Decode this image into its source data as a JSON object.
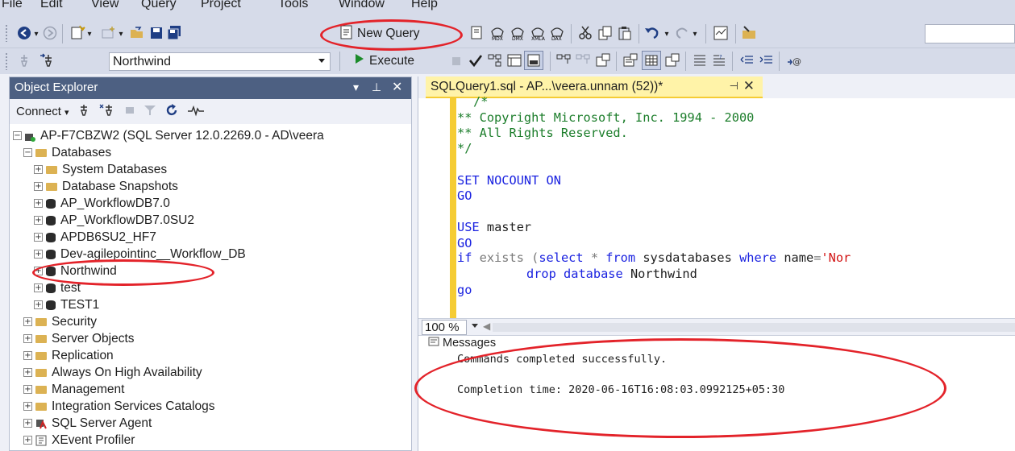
{
  "menu": {
    "items": [
      "File",
      "Edit",
      "View",
      "Query",
      "Project",
      "Tools",
      "Window",
      "Help"
    ]
  },
  "toolbar": {
    "new_query_label": "New Query",
    "database_selected": "Northwind",
    "execute_label": "Execute"
  },
  "object_explorer": {
    "title": "Object Explorer",
    "connect_label": "Connect",
    "server_node": "AP-F7CBZW2 (SQL Server 12.0.2269.0 - AD\\veera",
    "databases_folder": "Databases",
    "database_children": [
      "System Databases",
      "Database Snapshots",
      "AP_WorkflowDB7.0",
      "AP_WorkflowDB7.0SU2",
      "APDB6SU2_HF7",
      "Dev-agilepointinc__Workflow_DB",
      "Northwind",
      "test",
      "TEST1"
    ],
    "server_children": [
      "Security",
      "Server Objects",
      "Replication",
      "Always On High Availability",
      "Management",
      "Integration Services Catalogs",
      "SQL Server Agent",
      "XEvent Profiler"
    ]
  },
  "editor": {
    "tab_title": "SQLQuery1.sql - AP...\\veera.unnam (52))*",
    "code": {
      "l1": "/*",
      "l2": "** Copyright Microsoft, Inc. 1994 - 2000",
      "l3": "** All Rights Reserved.",
      "l4": "*/",
      "l5a": "SET",
      "l5b": "NOCOUNT",
      "l5c": "ON",
      "l6": "GO",
      "l7a": "USE",
      "l7b": "master",
      "l8": "GO",
      "l9a": "if",
      "l9b": "exists",
      "l9c": "(",
      "l9d": "select",
      "l9e": "*",
      "l9f": "from",
      "l9g": "sysdatabases",
      "l9h": "where",
      "l9i": "name",
      "l9j": "=",
      "l9k": "'Nor",
      "l10a": "drop database",
      "l10b": "Northwind",
      "l11": "go"
    },
    "zoom": "100 %",
    "messages_tab": "Messages",
    "messages": [
      "Commands completed successfully.",
      "Completion time: 2020-06-16T16:08:03.0992125+05:30"
    ]
  },
  "colors": {
    "annotation_red": "#e3232a",
    "panel_header": "#4d6082",
    "active_tab": "#fff3a8",
    "comment_green": "#1b7d2a",
    "keyword_blue": "#1a22e0"
  }
}
